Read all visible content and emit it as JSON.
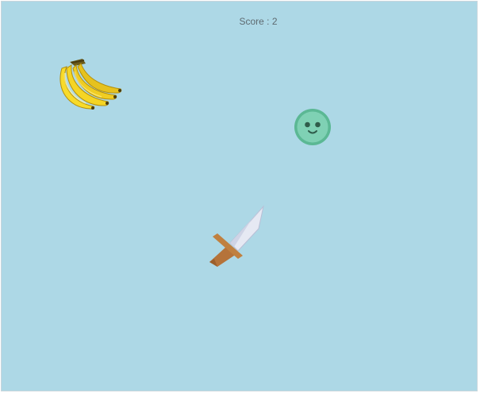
{
  "game": {
    "background_color": "#add8e6",
    "score_label": "Score : 2",
    "score": 2
  },
  "sprites": {
    "fruit": {
      "kind": "banana-bunch",
      "icon": "banana-icon"
    },
    "enemy": {
      "kind": "green-smiley-ball",
      "icon": "smiley-ball-icon",
      "color": "#7fd1b4"
    },
    "player": {
      "kind": "sword",
      "icon": "sword-icon",
      "blade_color": "#e6e9f3",
      "handle_color": "#c0803f"
    }
  }
}
